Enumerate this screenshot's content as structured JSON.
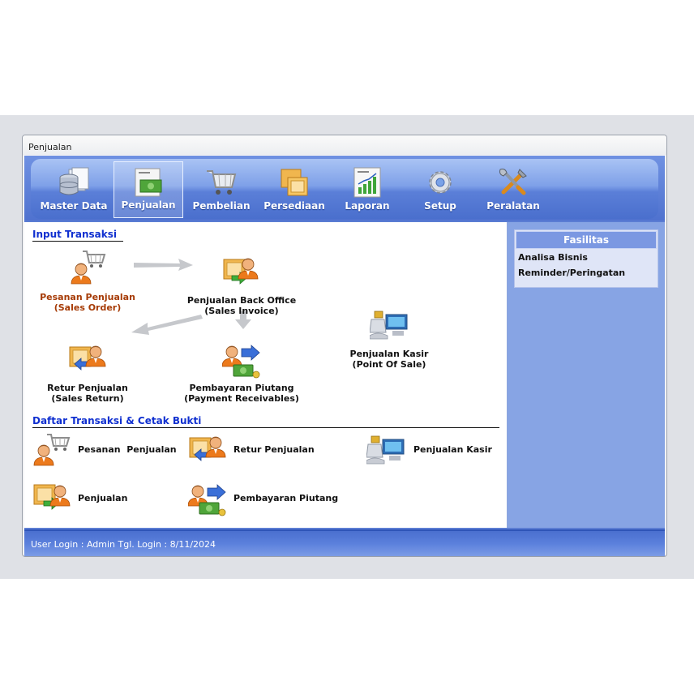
{
  "window": {
    "title": "Penjualan"
  },
  "toolbar": {
    "items": [
      {
        "label": "Master Data",
        "icon": "database-icon"
      },
      {
        "label": "Penjualan",
        "icon": "cash-invoice-icon",
        "active": true
      },
      {
        "label": "Pembelian",
        "icon": "shopping-cart-icon"
      },
      {
        "label": "Persediaan",
        "icon": "boxes-icon"
      },
      {
        "label": "Laporan",
        "icon": "report-chart-icon"
      },
      {
        "label": "Setup",
        "icon": "gear-icon"
      },
      {
        "label": "Peralatan",
        "icon": "tools-icon"
      }
    ]
  },
  "input_section": {
    "title": "Input Transaksi",
    "pesanan": {
      "line1": "Pesanan Penjualan",
      "line2": "(Sales Order)"
    },
    "backoffice": {
      "line1": "Penjualan Back Office",
      "line2": "(Sales Invoice)"
    },
    "kasir": {
      "line1": "Penjualan Kasir",
      "line2": "(Point Of Sale)"
    },
    "retur": {
      "line1": "Retur Penjualan",
      "line2": "(Sales Return)"
    },
    "piutang": {
      "line1": "Pembayaran Piutang",
      "line2": "(Payment Receivables)"
    }
  },
  "list_section": {
    "title": "Daftar Transaksi & Cetak Bukti",
    "items": {
      "pesanan": "Pesanan  Penjualan",
      "retur": "Retur Penjualan",
      "kasir": "Penjualan Kasir",
      "penjualan": "Penjualan",
      "piutang": "Pembayaran Piutang"
    }
  },
  "side": {
    "title": "Fasilitas",
    "items": [
      "Analisa Bisnis",
      "Reminder/Peringatan"
    ]
  },
  "status": {
    "text": "User Login : Admin Tgl. Login : 8/11/2024"
  },
  "colors": {
    "accent": "#5b7dd3",
    "section_title": "#1030d0",
    "sales_order_text": "#a63b06"
  }
}
